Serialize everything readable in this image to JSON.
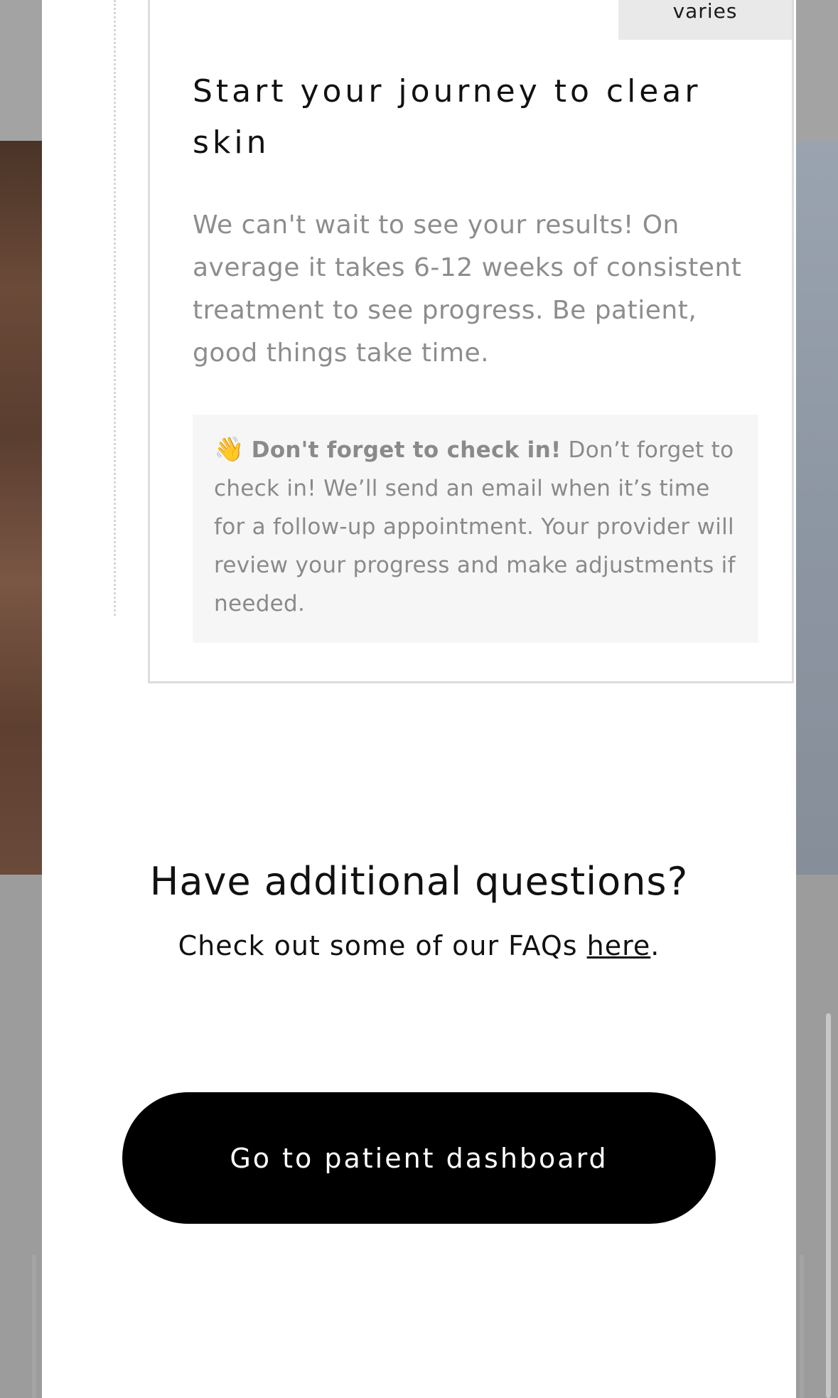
{
  "card": {
    "tag_label": "varies",
    "title": "Start your journey to clear skin",
    "body": "We can't wait to see your results! On average it takes 6-12 weeks of consistent treatment to see progress. Be patient, good things take time.",
    "callout": {
      "emoji": "👋",
      "bold_text": "Don't forget to check in!",
      "text": " Don’t forget to check in! We’ll send an email when it’s time for a follow-up appointment. Your provider will review your progress and make adjustments if needed."
    }
  },
  "faq": {
    "title": "Have additional questions?",
    "text_prefix": "Check out some of our FAQs ",
    "link_label": "here",
    "text_suffix": "."
  },
  "primary_button": {
    "label": "Go to patient dashboard"
  }
}
